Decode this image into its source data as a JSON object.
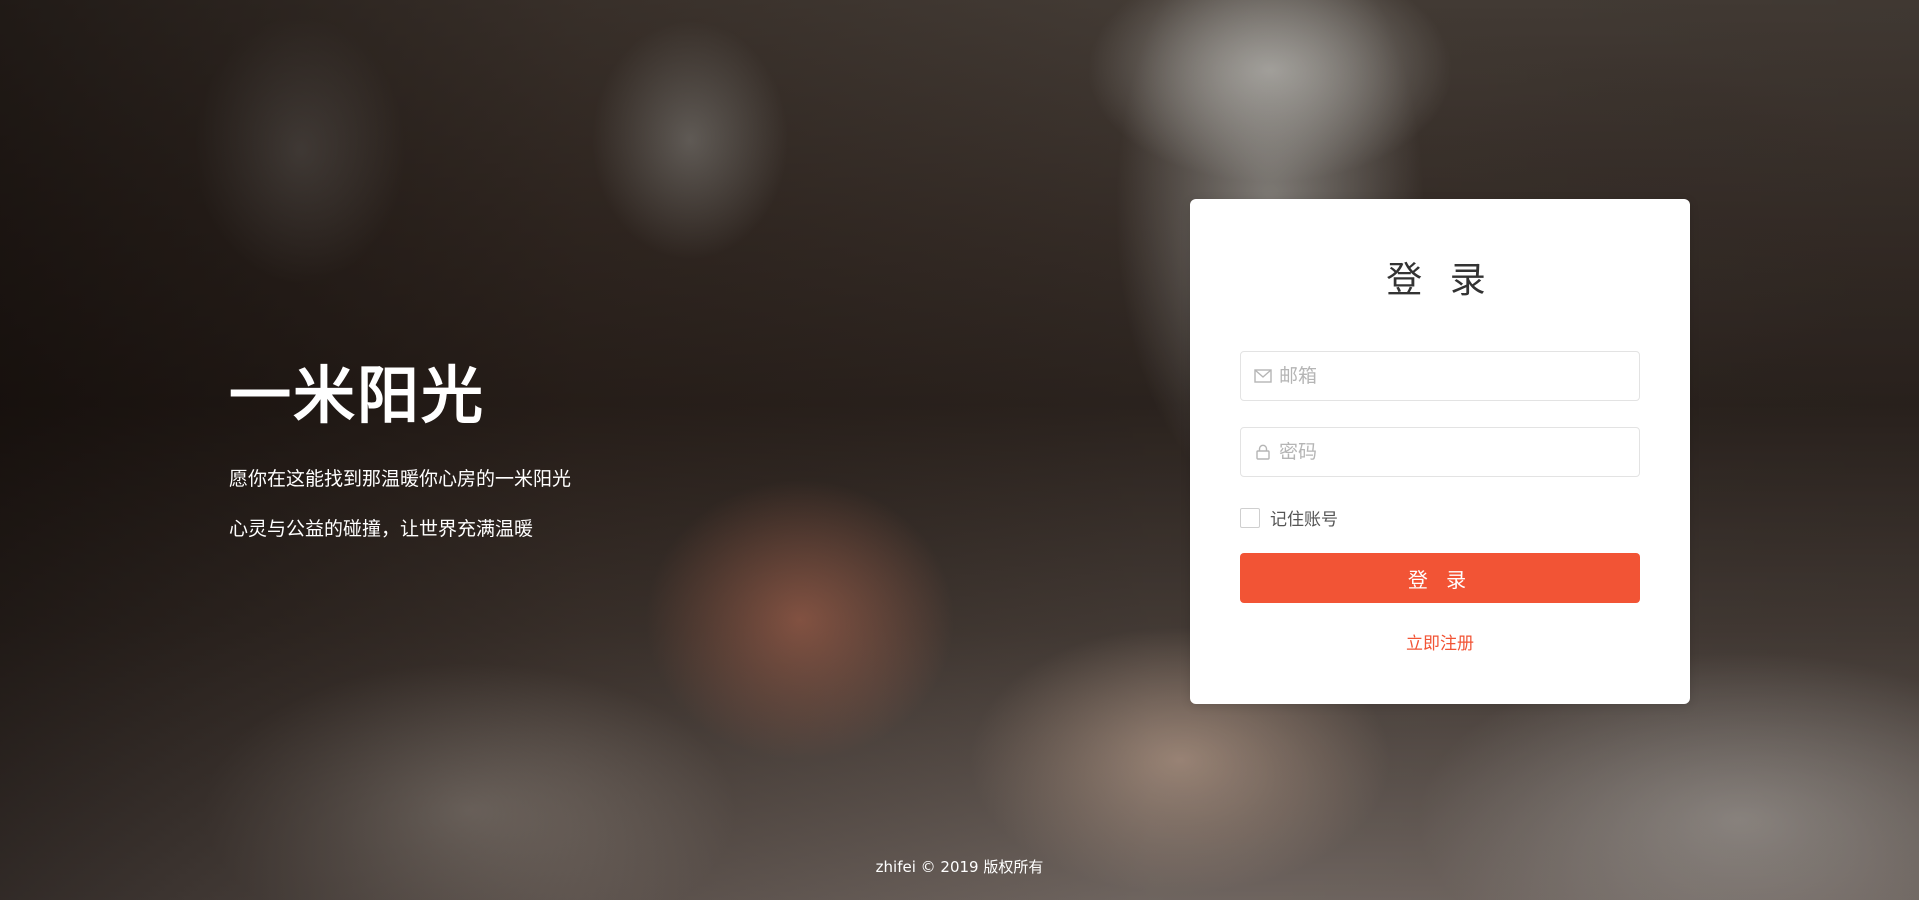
{
  "hero": {
    "title": "一米阳光",
    "line1": "愿你在这能找到那温暖你心房的一米阳光",
    "line2": "心灵与公益的碰撞，让世界充满温暖"
  },
  "login": {
    "title": "登 录",
    "email_placeholder": "邮箱",
    "password_placeholder": "密码",
    "remember_label": "记住账号",
    "submit_label": "登 录",
    "register_link": "立即注册"
  },
  "icons": {
    "email": "mail-icon",
    "password": "lock-icon"
  },
  "colors": {
    "accent": "#f25435",
    "card_bg": "#ffffff",
    "title": "#333333",
    "placeholder": "#b5b5b5"
  },
  "footer": {
    "text": "zhifei © 2019 版权所有"
  }
}
